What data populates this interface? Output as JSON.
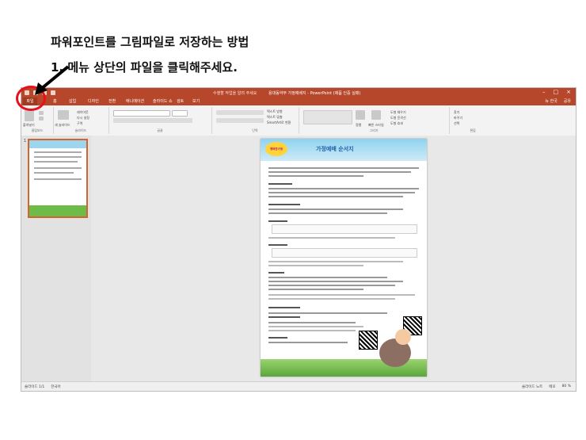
{
  "instructions": {
    "heading": "파워포인트를 그림파일로 저장하는 방법",
    "step1": "1. 메뉴 상단의 파일을 클릭해주세요."
  },
  "window": {
    "title": "용대동약부 가정예배지 - PowerPoint (제품 인증 실패)",
    "tell_me": "수행할 작업을 알려 주세요",
    "account": "뉴 한국",
    "share": "공유"
  },
  "tabs": [
    "파일",
    "홈",
    "삽입",
    "디자인",
    "전환",
    "애니메이션",
    "슬라이드 쇼",
    "검토",
    "보기"
  ],
  "ribbon": {
    "groups": [
      "클립보드",
      "슬라이드",
      "글꼴",
      "단락",
      "그리기",
      "편집"
    ],
    "items": {
      "paste": "붙여넣기",
      "new_slide": "새 슬라이드",
      "layout": "레이아웃",
      "reset": "다시 설정",
      "section": "구역",
      "arrange": "정렬",
      "quick_styles": "빠른 스타일",
      "find": "찾기",
      "replace": "바꾸기",
      "select": "선택",
      "text_direction": "텍스트 방향",
      "align_text": "텍스트 맞춤",
      "smartart": "SmartArt로 변환",
      "shape_fill": "도형 채우기",
      "shape_outline": "도형 윤곽선",
      "shape_effects": "도형 효과"
    }
  },
  "thumbnail": {
    "number": "1"
  },
  "slide": {
    "title": "가정예배 순서지",
    "logo": "행복한가정"
  },
  "status": {
    "slide": "슬라이드 1/1",
    "language": "한국어",
    "notes": "슬라이드 노트",
    "comments": "메모",
    "zoom": "80 %"
  }
}
